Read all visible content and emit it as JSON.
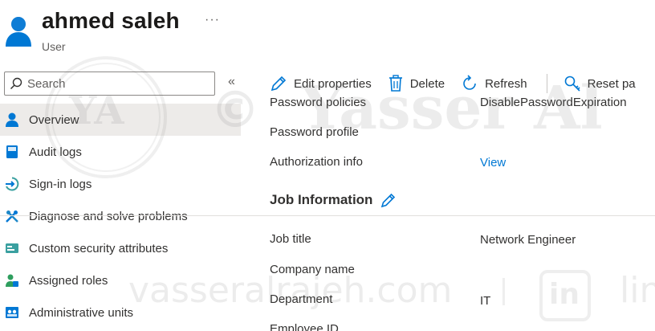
{
  "header": {
    "title": "ahmed saleh",
    "subtitle": "User",
    "more": "···",
    "icon": "user-icon"
  },
  "search": {
    "placeholder": "Search",
    "collapse": "«"
  },
  "sidebar": {
    "items": [
      {
        "label": "Overview",
        "icon": "user-icon",
        "active": true
      },
      {
        "label": "Audit logs",
        "icon": "book-icon"
      },
      {
        "label": "Sign-in logs",
        "icon": "sign-in-icon"
      },
      {
        "label": "Diagnose and solve problems",
        "icon": "wrench-icon"
      },
      {
        "label": "Custom security attributes",
        "icon": "attributes-icon"
      },
      {
        "label": "Assigned roles",
        "icon": "roles-icon"
      },
      {
        "label": "Administrative units",
        "icon": "admin-units-icon"
      }
    ]
  },
  "toolbar": {
    "edit_label": "Edit properties",
    "delete_label": "Delete",
    "refresh_label": "Refresh",
    "reset_label": "Reset pa"
  },
  "content": {
    "rows_top": [
      {
        "label": "Password policies",
        "value": "DisablePasswordExpiration"
      },
      {
        "label": "Password profile",
        "value": ""
      },
      {
        "label": "Authorization info",
        "value": "View"
      }
    ],
    "section_title": "Job Information",
    "rows_job": [
      {
        "label": "Job title",
        "value": "Network Engineer"
      },
      {
        "label": "Company name",
        "value": ""
      },
      {
        "label": "Department",
        "value": "IT"
      },
      {
        "label": "Employee ID",
        "value": ""
      }
    ]
  },
  "watermark": {
    "logo": "YA",
    "copyright": "©",
    "name": "Yasser Al",
    "site": "vasseralrajeh.com",
    "in_badge": "in",
    "tail": "lin"
  },
  "colors": {
    "accent": "#0078d4",
    "active_bg": "#edebe9",
    "text": "#323130"
  }
}
